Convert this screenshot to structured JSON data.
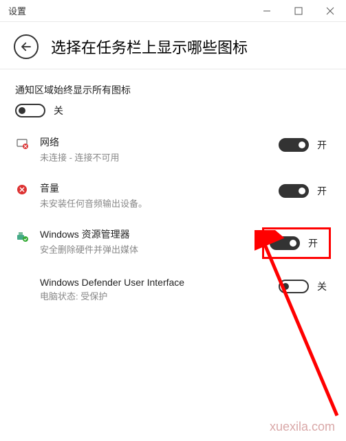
{
  "window": {
    "title": "设置"
  },
  "page": {
    "title": "选择在任务栏上显示哪些图标"
  },
  "subtitle": "通知区域始终显示所有图标",
  "labels": {
    "on": "开",
    "off": "关"
  },
  "master": {
    "state": "off"
  },
  "items": [
    {
      "name": "网络",
      "desc": "未连接 - 连接不可用",
      "state": "on",
      "icon": "network"
    },
    {
      "name": "音量",
      "desc": "未安装任何音频输出设备。",
      "state": "on",
      "icon": "volume"
    },
    {
      "name": "Windows 资源管理器",
      "desc": "安全删除硬件并弹出媒体",
      "state": "on",
      "icon": "explorer",
      "highlighted": true
    },
    {
      "name": "Windows Defender User Interface",
      "desc": "电脑状态: 受保护",
      "state": "off",
      "icon": "defender"
    }
  ],
  "watermark": "xuexila.com"
}
